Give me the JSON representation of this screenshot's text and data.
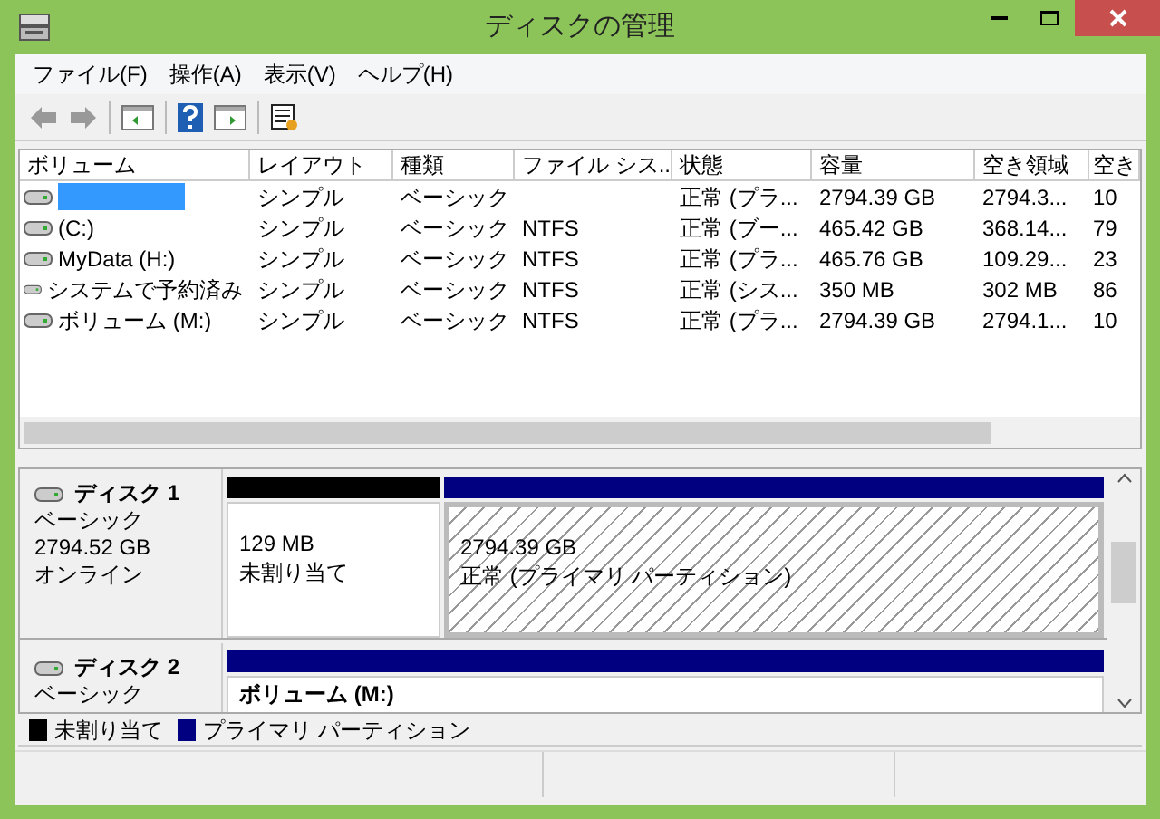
{
  "window": {
    "title": "ディスクの管理"
  },
  "menu": [
    "ファイル(F)",
    "操作(A)",
    "表示(V)",
    "ヘルプ(H)"
  ],
  "table": {
    "columns": [
      "ボリューム",
      "レイアウト",
      "種類",
      "ファイル シス...",
      "状態",
      "容量",
      "空き領域",
      "空き"
    ],
    "rows": [
      {
        "selected": true,
        "cells": [
          "",
          "シンプル",
          "ベーシック",
          "",
          "正常 (プラ...",
          "2794.39 GB",
          "2794.3...",
          "10"
        ]
      },
      {
        "selected": false,
        "cells": [
          "(C:)",
          "シンプル",
          "ベーシック",
          "NTFS",
          "正常 (ブー...",
          "465.42 GB",
          "368.14...",
          "79"
        ]
      },
      {
        "selected": false,
        "cells": [
          "MyData (H:)",
          "シンプル",
          "ベーシック",
          "NTFS",
          "正常 (プラ...",
          "465.76 GB",
          "109.29...",
          "23"
        ]
      },
      {
        "selected": false,
        "cells": [
          "システムで予約済み",
          "シンプル",
          "ベーシック",
          "NTFS",
          "正常 (シス...",
          "350 MB",
          "302 MB",
          "86"
        ]
      },
      {
        "selected": false,
        "cells": [
          "ボリューム (M:)",
          "シンプル",
          "ベーシック",
          "NTFS",
          "正常 (プラ...",
          "2794.39 GB",
          "2794.1...",
          "10"
        ]
      }
    ]
  },
  "disks": [
    {
      "name": "ディスク 1",
      "lines": [
        "ベーシック",
        "2794.52 GB",
        "オンライン"
      ],
      "partitions": [
        {
          "kind": "unallocated",
          "selected": false,
          "lines": [
            "129 MB",
            "未割り当て"
          ]
        },
        {
          "kind": "primary",
          "selected": true,
          "lines": [
            "2794.39 GB",
            "正常 (プライマリ パーティション)"
          ]
        }
      ]
    },
    {
      "name": "ディスク 2",
      "lines": [
        "ベーシック"
      ],
      "partitions": [
        {
          "kind": "primary",
          "selected": false,
          "title": "ボリューム (M:)"
        }
      ]
    }
  ],
  "legend": [
    {
      "kind": "unallocated",
      "label": "未割り当て"
    },
    {
      "kind": "primary",
      "label": "プライマリ パーティション"
    }
  ]
}
